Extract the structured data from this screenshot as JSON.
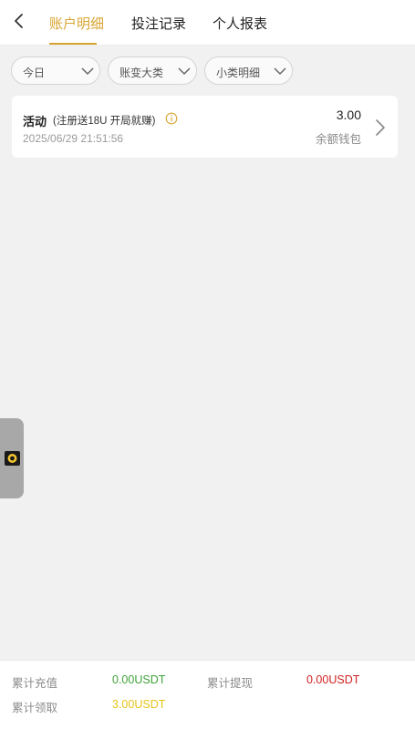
{
  "header": {
    "tabs": [
      {
        "label": "账户明细",
        "active": true
      },
      {
        "label": "投注记录",
        "active": false
      },
      {
        "label": "个人报表",
        "active": false
      }
    ],
    "back_icon": "chevron-left-icon"
  },
  "filters": [
    {
      "label": "今日"
    },
    {
      "label": "账变大类"
    },
    {
      "label": "小类明细"
    }
  ],
  "records": [
    {
      "title": "活动",
      "subtitle": "(注册送18U 开局就赚)",
      "time": "2025/06/29 21:51:56",
      "amount": "3.00",
      "wallet": "余额钱包"
    }
  ],
  "footer": {
    "recharge_label": "累计充值",
    "recharge_value": "0.00USDT",
    "withdraw_label": "累计提现",
    "withdraw_value": "0.00USDT",
    "claim_label": "累计领取",
    "claim_value": "3.00USDT"
  },
  "colors": {
    "accent": "#d8a431",
    "green": "#3ea338",
    "red": "#d22121",
    "yellow": "#e7c41b"
  }
}
